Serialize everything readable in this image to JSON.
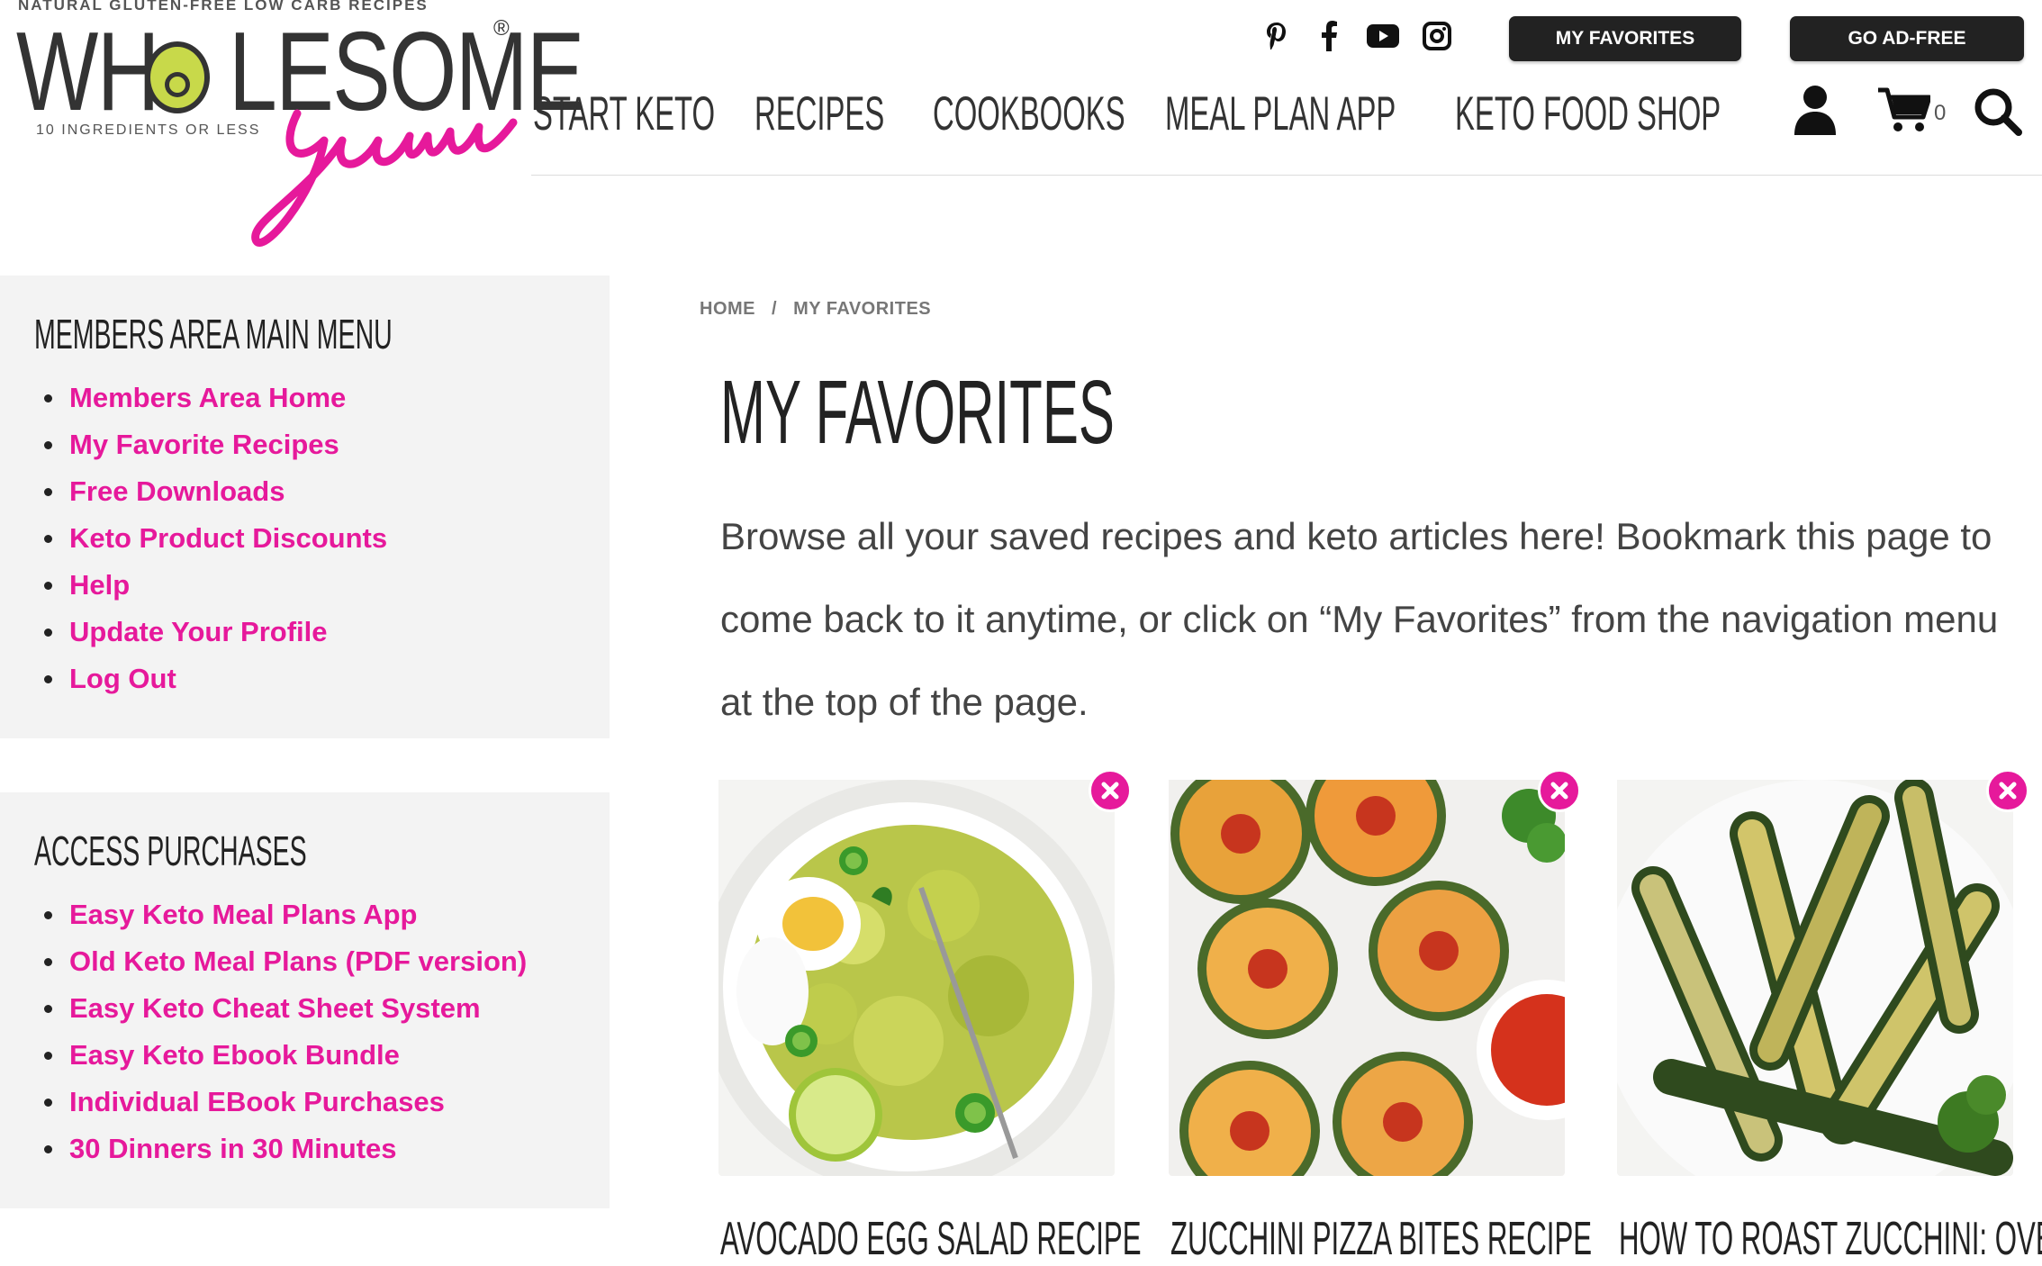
{
  "brand": {
    "tagline_top": "NATURAL GLUTEN-FREE LOW CARB RECIPES",
    "wordmark_left": "WH",
    "wordmark_right": "LESOME",
    "registered": "®",
    "script": "yum",
    "subtitle": "10 INGREDIENTS OR LESS",
    "accent_color": "#e6199b"
  },
  "header": {
    "social": [
      {
        "name": "pinterest-icon",
        "glyph": "P"
      },
      {
        "name": "facebook-icon",
        "glyph": "f"
      },
      {
        "name": "youtube-icon",
        "glyph": "▶"
      },
      {
        "name": "instagram-icon",
        "glyph": "◎"
      }
    ],
    "favorites_button": "MY FAVORITES",
    "ad_free_button": "GO AD-FREE",
    "nav": [
      "START KETO",
      "RECIPES",
      "COOKBOOKS",
      "MEAL PLAN APP",
      "KETO FOOD SHOP"
    ],
    "cart_count": "0"
  },
  "sidebar": {
    "members": {
      "title": "MEMBERS AREA MAIN MENU",
      "items": [
        "Members Area Home",
        "My Favorite Recipes",
        "Free Downloads",
        "Keto Product Discounts",
        "Help",
        "Update Your Profile",
        "Log Out"
      ]
    },
    "purchases": {
      "title": "ACCESS PURCHASES",
      "items": [
        "Easy Keto Meal Plans App",
        "Old Keto Meal Plans (PDF version)",
        "Easy Keto Cheat Sheet System",
        "Easy Keto Ebook Bundle",
        "Individual EBook Purchases",
        "30 Dinners in 30 Minutes"
      ]
    }
  },
  "main": {
    "breadcrumb": {
      "home": "HOME",
      "separator": "/",
      "current": "MY FAVORITES"
    },
    "title": "MY FAVORITES",
    "intro": "Browse all your saved recipes and keto articles here! Bookmark this page to come back to it anytime, or click on “My Favorites” from the navigation menu at the top of the page.",
    "cards": [
      {
        "title": "AVOCADO EGG SALAD RECIPE"
      },
      {
        "title": "ZUCCHINI PIZZA BITES RECIPE"
      },
      {
        "title": "HOW TO ROAST ZUCCHINI: OVEN"
      }
    ]
  }
}
